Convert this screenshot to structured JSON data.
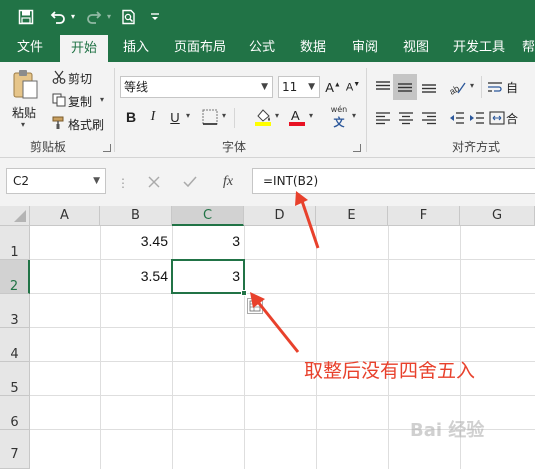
{
  "quick_access": {
    "save_icon": "save-icon",
    "undo_icon": "undo-icon",
    "redo_icon": "redo-icon",
    "print_preview_icon": "print-preview-icon",
    "customize_icon": "customize-qat-icon"
  },
  "tabs": [
    {
      "label": "文件"
    },
    {
      "label": "开始",
      "active": true
    },
    {
      "label": "插入"
    },
    {
      "label": "页面布局"
    },
    {
      "label": "公式"
    },
    {
      "label": "数据"
    },
    {
      "label": "审阅"
    },
    {
      "label": "视图"
    },
    {
      "label": "开发工具"
    },
    {
      "label": "帮"
    }
  ],
  "ribbon": {
    "clipboard": {
      "paste_label": "粘贴",
      "cut_label": "剪切",
      "copy_label": "复制",
      "format_painter_label": "格式刷",
      "group_label": "剪贴板"
    },
    "font": {
      "font_name": "等线",
      "font_size": "11",
      "bold": "B",
      "italic": "I",
      "underline": "U",
      "phonetic": "wén",
      "group_label": "字体"
    },
    "alignment": {
      "wrap_label": "自",
      "merge_label": "合",
      "group_label": "对齐方式"
    }
  },
  "formula_bar": {
    "name_box": "C2",
    "fx_label": "fx",
    "formula": "=INT(B2)"
  },
  "grid": {
    "columns": [
      "A",
      "B",
      "C",
      "D",
      "E",
      "F",
      "G"
    ],
    "rows": [
      "1",
      "2",
      "3",
      "4",
      "5",
      "6",
      "7"
    ],
    "cells": {
      "B1": "3.45",
      "C1": "3",
      "B2": "3.54",
      "C2": "3"
    },
    "selected_cell": "C2"
  },
  "annotation": {
    "text": "取整后没有四舍五入",
    "color": "#e8412c"
  },
  "watermark": "Bai 经验",
  "colors": {
    "excel_green": "#217346",
    "annotation_red": "#e8412c"
  }
}
